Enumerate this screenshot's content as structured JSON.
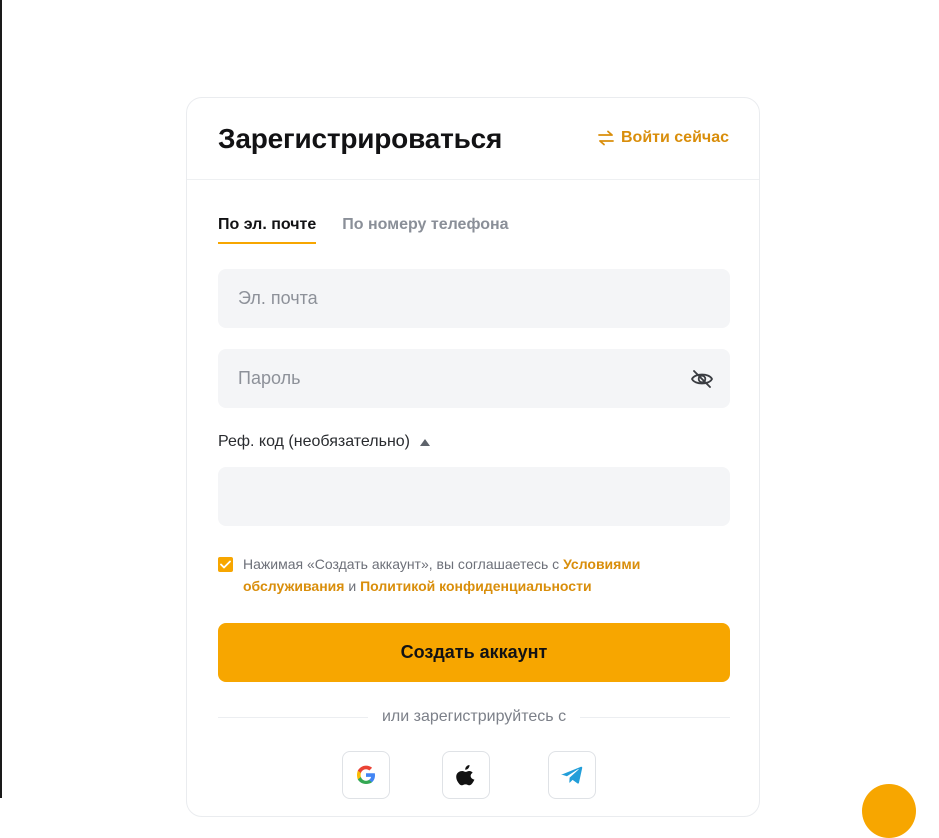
{
  "header": {
    "title": "Зарегистрироваться",
    "login_link": "Войти сейчас"
  },
  "tabs": [
    {
      "label": "По эл. почте",
      "active": true
    },
    {
      "label": "По номеру телефона",
      "active": false
    }
  ],
  "form": {
    "email_placeholder": "Эл. почта",
    "email_value": "",
    "password_placeholder": "Пароль",
    "password_value": "",
    "ref_label": "Реф. код (необязательно)",
    "ref_value": "",
    "agree_checked": true,
    "agree_prefix": "Нажимая «Создать аккаунт», вы соглашаетесь с ",
    "terms_link": "Условиями обслуживания",
    "agree_and": " и ",
    "privacy_link": "Политикой конфиденциальности",
    "submit_label": "Создать аккаунт"
  },
  "social": {
    "divider_text": "или зарегистрируйтесь с",
    "providers": [
      "google-icon",
      "apple-icon",
      "telegram-icon"
    ]
  },
  "colors": {
    "accent": "#f7a600",
    "link": "#d98e0b",
    "field_bg": "#f4f5f7"
  }
}
